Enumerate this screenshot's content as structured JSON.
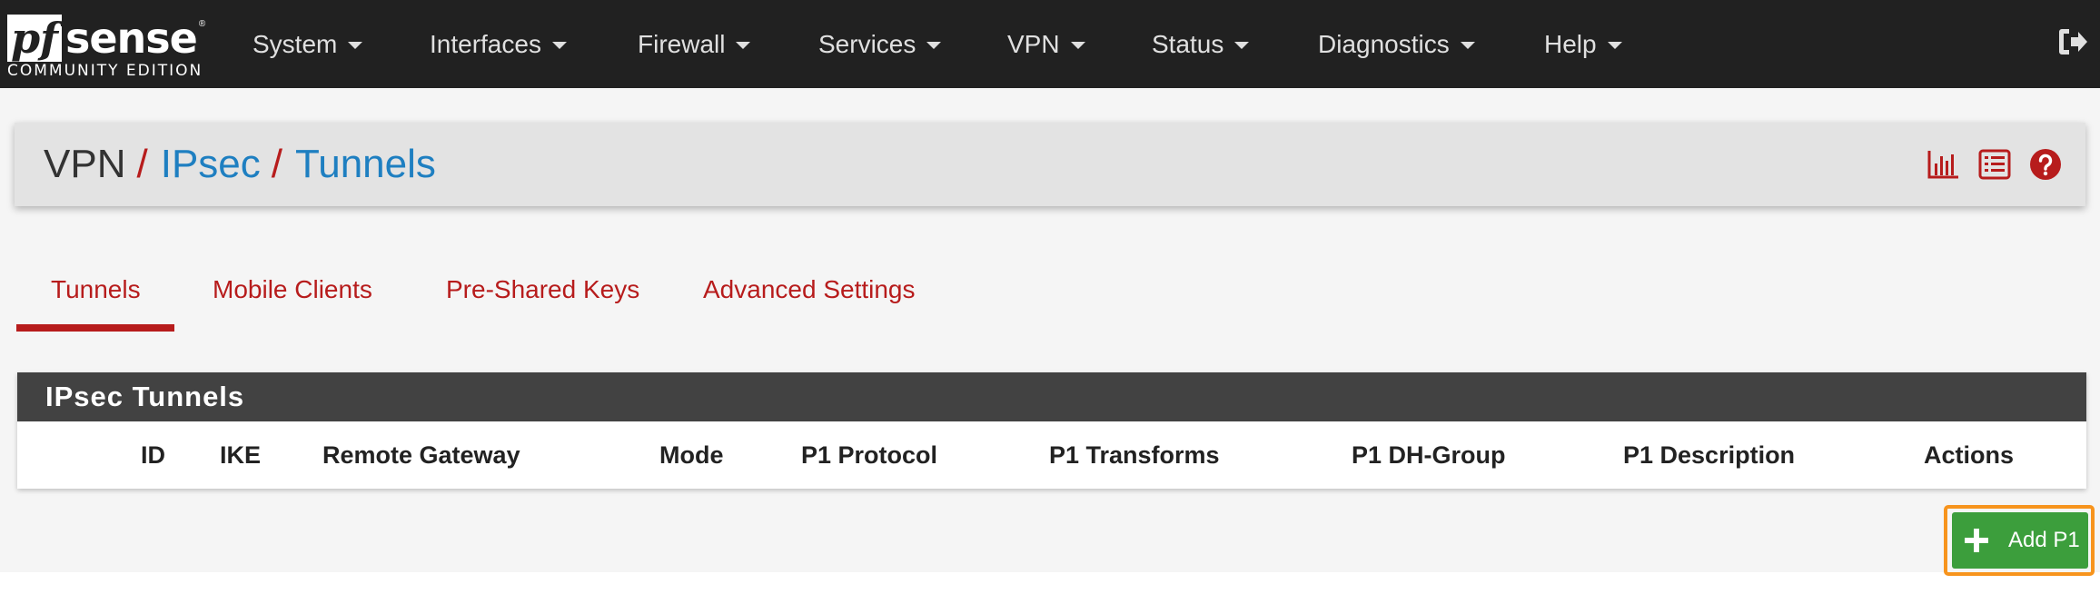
{
  "brand": {
    "logo_pf": "pf",
    "logo_sense": "sense",
    "logo_reg": "®",
    "edition": "COMMUNITY EDITION"
  },
  "nav": {
    "system": "System",
    "interfaces": "Interfaces",
    "firewall": "Firewall",
    "services": "Services",
    "vpn": "VPN",
    "status": "Status",
    "diagnostics": "Diagnostics",
    "help": "Help"
  },
  "breadcrumb": {
    "root": "VPN",
    "sep1": "/",
    "level2": "IPsec",
    "sep2": "/",
    "current": "Tunnels"
  },
  "header_icons": [
    "bar-chart-icon",
    "list-icon",
    "help-icon"
  ],
  "tabs": {
    "tunnels": "Tunnels",
    "mobile_clients": "Mobile Clients",
    "pre_shared_keys": "Pre-Shared Keys",
    "advanced_settings": "Advanced Settings",
    "active": "Tunnels"
  },
  "panel": {
    "title": "IPsec Tunnels",
    "columns": {
      "id": "ID",
      "ike": "IKE",
      "remote_gateway": "Remote Gateway",
      "mode": "Mode",
      "p1_protocol": "P1 Protocol",
      "p1_transforms": "P1 Transforms",
      "p1_dh_group": "P1 DH-Group",
      "p1_description": "P1 Description",
      "actions": "Actions"
    }
  },
  "add_button": {
    "label": "Add P1",
    "icon": "plus-icon"
  },
  "colors": {
    "navbar": "#212121",
    "accent_red": "#b71c1c",
    "link_blue": "#1e7fc1",
    "button_green": "#3c9e3c",
    "highlight_orange": "#f7941d"
  }
}
